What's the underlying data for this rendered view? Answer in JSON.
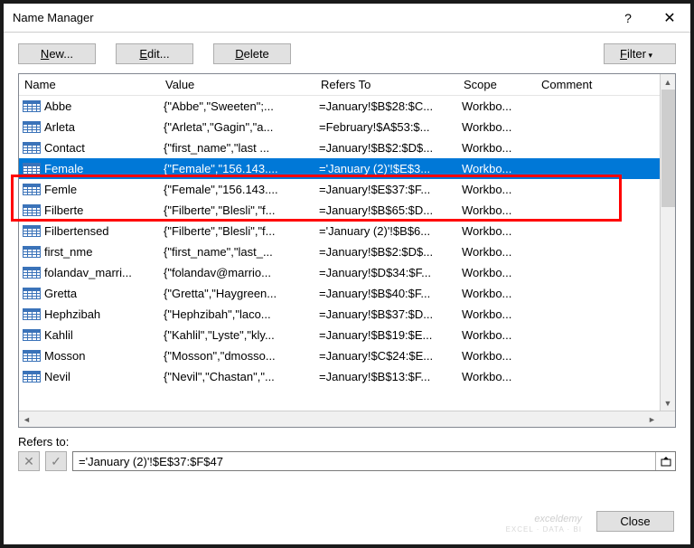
{
  "title": "Name Manager",
  "toolbar": {
    "new": "New...",
    "edit": "Edit...",
    "delete": "Delete",
    "filter": "Filter"
  },
  "headers": {
    "name": "Name",
    "value": "Value",
    "refers": "Refers To",
    "scope": "Scope",
    "comment": "Comment"
  },
  "rows": [
    {
      "name": "Abbe",
      "value": "{\"Abbe\",\"Sweeten\";...",
      "refers": "=January!$B$28:$C...",
      "scope": "Workbo...",
      "selected": false
    },
    {
      "name": "Arleta",
      "value": "{\"Arleta\",\"Gagin\",\"a...",
      "refers": "=February!$A$53:$...",
      "scope": "Workbo...",
      "selected": false
    },
    {
      "name": "Contact",
      "value": "{\"first_name\",\"last ...",
      "refers": "=January!$B$2:$D$...",
      "scope": "Workbo...",
      "selected": false
    },
    {
      "name": "Female",
      "value": "{\"Female\",\"156.143....",
      "refers": "='January (2)'!$E$3...",
      "scope": "Workbo...",
      "selected": true
    },
    {
      "name": "Femle",
      "value": "{\"Female\",\"156.143....",
      "refers": "=January!$E$37:$F...",
      "scope": "Workbo...",
      "selected": false
    },
    {
      "name": "Filberte",
      "value": "{\"Filberte\",\"Blesli\",\"f...",
      "refers": "=January!$B$65:$D...",
      "scope": "Workbo...",
      "selected": false
    },
    {
      "name": "Filbertensed",
      "value": "{\"Filberte\",\"Blesli\",\"f...",
      "refers": "='January (2)'!$B$6...",
      "scope": "Workbo...",
      "selected": false
    },
    {
      "name": "first_nme",
      "value": "{\"first_name\",\"last_...",
      "refers": "=January!$B$2:$D$...",
      "scope": "Workbo...",
      "selected": false
    },
    {
      "name": "folandav_marri...",
      "value": "{\"folandav@marrio...",
      "refers": "=January!$D$34:$F...",
      "scope": "Workbo...",
      "selected": false
    },
    {
      "name": "Gretta",
      "value": "{\"Gretta\",\"Haygreen...",
      "refers": "=January!$B$40:$F...",
      "scope": "Workbo...",
      "selected": false
    },
    {
      "name": "Hephzibah",
      "value": "{\"Hephzibah\",\"laco...",
      "refers": "=January!$B$37:$D...",
      "scope": "Workbo...",
      "selected": false
    },
    {
      "name": "Kahlil",
      "value": "{\"Kahlil\",\"Lyste\",\"kly...",
      "refers": "=January!$B$19:$E...",
      "scope": "Workbo...",
      "selected": false
    },
    {
      "name": "Mosson",
      "value": "{\"Mosson\",\"dmosso...",
      "refers": "=January!$C$24:$E...",
      "scope": "Workbo...",
      "selected": false
    },
    {
      "name": "Nevil",
      "value": "{\"Nevil\",\"Chastan\",\"...",
      "refers": "=January!$B$13:$F...",
      "scope": "Workbo...",
      "selected": false
    }
  ],
  "refersTo": {
    "label": "Refers to:",
    "value": "='January (2)'!$E$37:$F$47"
  },
  "close": "Close",
  "watermark": "exceldemy",
  "watermarkSub": "EXCEL · DATA · BI"
}
